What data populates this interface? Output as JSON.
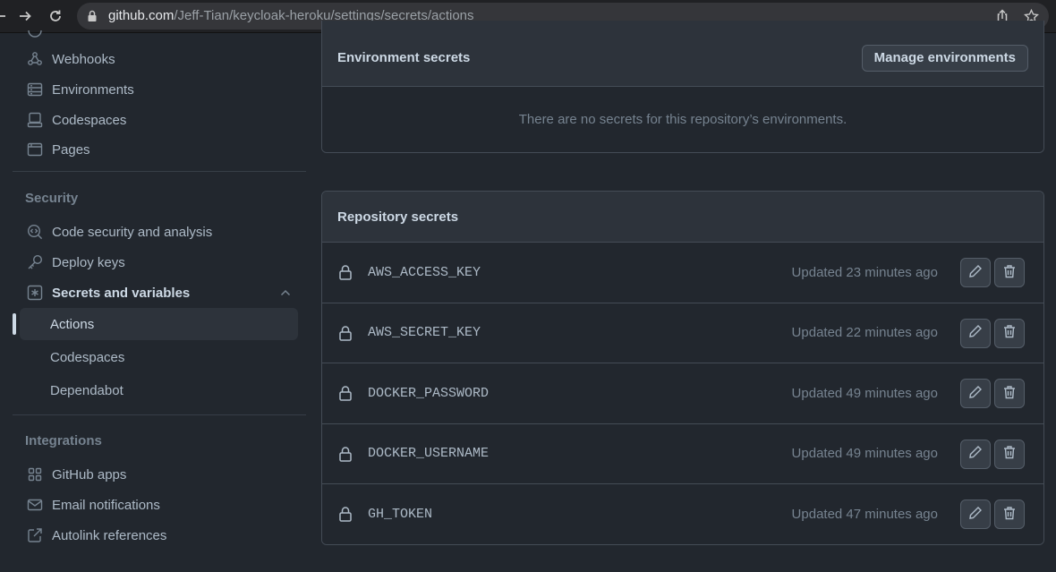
{
  "browser": {
    "url_host": "github.com",
    "url_path": "/Jeff-Tian/keycloak-heroku/settings/secrets/actions"
  },
  "sidebar": {
    "top_items": [
      {
        "label": "Webhooks",
        "icon": "webhook-icon"
      },
      {
        "label": "Environments",
        "icon": "server-icon"
      },
      {
        "label": "Codespaces",
        "icon": "codespaces-icon"
      },
      {
        "label": "Pages",
        "icon": "browser-icon"
      }
    ],
    "security_heading": "Security",
    "security_items": [
      {
        "label": "Code security and analysis",
        "icon": "codescan-icon"
      },
      {
        "label": "Deploy keys",
        "icon": "key-icon"
      },
      {
        "label": "Secrets and variables",
        "icon": "asterisk-icon"
      }
    ],
    "secrets_subitems": [
      {
        "label": "Actions"
      },
      {
        "label": "Codespaces"
      },
      {
        "label": "Dependabot"
      }
    ],
    "integrations_heading": "Integrations",
    "integration_items": [
      {
        "label": "GitHub apps",
        "icon": "apps-icon"
      },
      {
        "label": "Email notifications",
        "icon": "mail-icon"
      },
      {
        "label": "Autolink references",
        "icon": "link-external-icon"
      }
    ]
  },
  "environment_secrets": {
    "title": "Environment secrets",
    "manage_button": "Manage environments",
    "empty_message": "There are no secrets for this repository’s environments."
  },
  "repository_secrets": {
    "title": "Repository secrets",
    "rows": [
      {
        "name": "AWS_ACCESS_KEY",
        "updated": "Updated 23 minutes ago"
      },
      {
        "name": "AWS_SECRET_KEY",
        "updated": "Updated 22 minutes ago"
      },
      {
        "name": "DOCKER_PASSWORD",
        "updated": "Updated 49 minutes ago"
      },
      {
        "name": "DOCKER_USERNAME",
        "updated": "Updated 49 minutes ago"
      },
      {
        "name": "GH_TOKEN",
        "updated": "Updated 47 minutes ago"
      }
    ]
  },
  "colors": {
    "background": "#22272e",
    "panel_header": "#2d333b",
    "border": "#444c56",
    "text": "#adbac7",
    "muted": "#768390"
  }
}
